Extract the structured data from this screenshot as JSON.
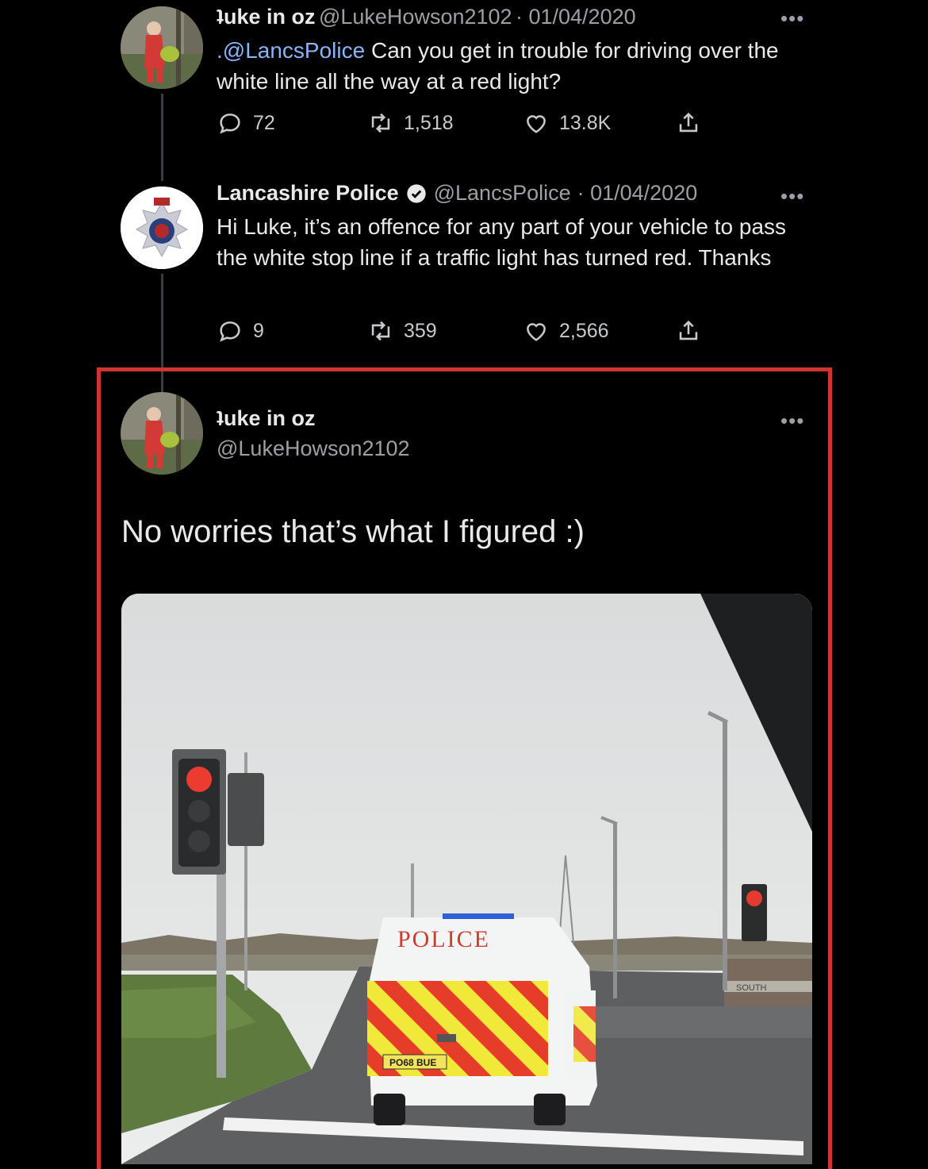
{
  "tweet1": {
    "display_name": "ʇuke in oz",
    "handle": "@LukeHowson2102",
    "date": "· 01/04/2020",
    "mention": ".@LancsPolice",
    "text": " Can you get in trouble for driving over the white line all the way at a red light?",
    "replies": "72",
    "retweets": "1,518",
    "likes": "13.8K",
    "more": "•••"
  },
  "tweet2": {
    "display_name": "Lancashire Police",
    "handle": "@LancsPolice",
    "date": "· 01/04/2020",
    "text": "Hi Luke, it’s an offence for any part of your vehicle to pass the white stop line if a traffic light has turned red. Thanks",
    "replies": "9",
    "retweets": "359",
    "likes": "2,566",
    "more": "•••"
  },
  "tweet3": {
    "display_name": "ʇuke in oz",
    "handle": "@LukeHowson2102",
    "text": "No worries that’s what I figured :)",
    "more": "•••",
    "photo": {
      "van_label": "POLICE",
      "plate": "PO68 BUE",
      "sign_text": "SOUTH"
    }
  },
  "colors": {
    "background": "#000000",
    "text": "#e7e9ea",
    "muted": "#9aa0a6",
    "mention": "#8ab4f8",
    "highlight": "#d0342c"
  }
}
